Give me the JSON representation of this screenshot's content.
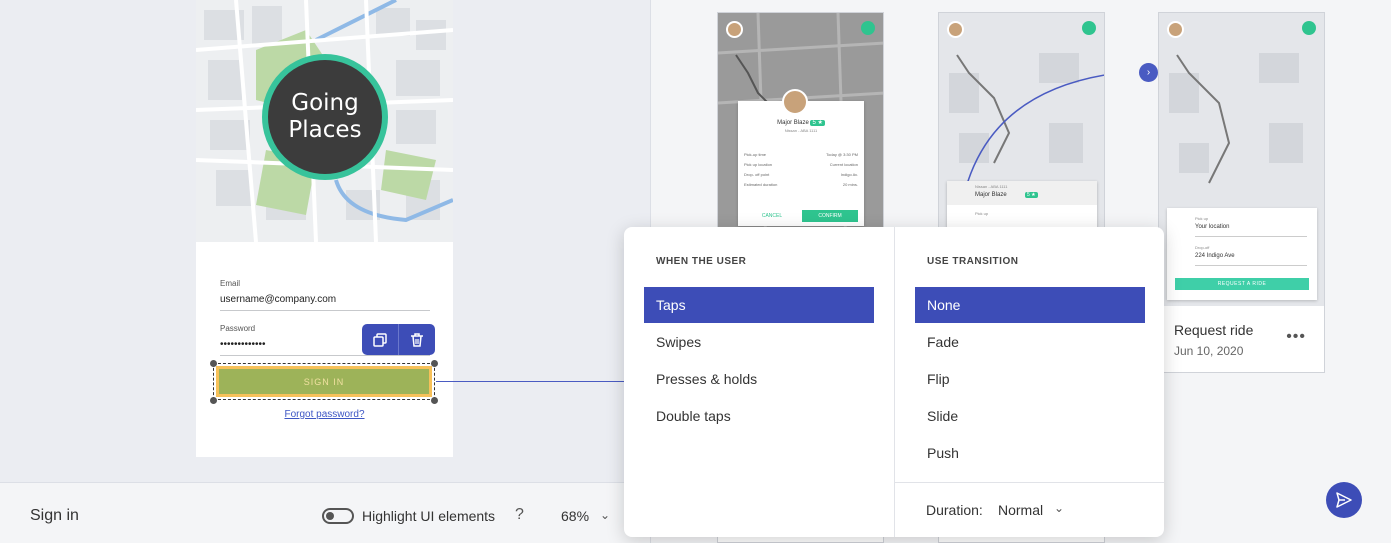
{
  "canvas": {
    "logo_line1": "Going",
    "logo_line2": "Places",
    "email_label": "Email",
    "email_value": "username@company.com",
    "password_label": "Password",
    "password_value": "•••••••••••••",
    "signin_label": "SIGN IN",
    "forgot_label": "Forgot password?"
  },
  "bottom_bar": {
    "screen_name": "Sign in",
    "highlight_label": "Highlight UI elements",
    "help": "?",
    "zoom": "68%",
    "zoom_chevron": "⌄"
  },
  "mini_screens": {
    "first": {
      "driver_name": "Major Blaze",
      "rating": "5 ★",
      "vehicle": "Nissan - ABA 1111",
      "rows": [
        {
          "label": "Pick-up time",
          "value": "Today @ 3:30 PM"
        },
        {
          "label": "Pick up location",
          "value": "Current location"
        },
        {
          "label": "Drop- off point",
          "value": "Indigo Av."
        },
        {
          "label": "Estimated duration",
          "value": "20 mins."
        }
      ],
      "cancel": "CANCEL",
      "confirm": "CONFIRM"
    },
    "second": {
      "vehicle": "Nissan - ABA 1111",
      "driver_name": "Major Blaze",
      "rating": "5 ★",
      "pickup": "Pick up"
    },
    "third": {
      "pickup_label": "Pick up",
      "pickup_value": "Your location",
      "dropoff_label": "Drop-off",
      "dropoff_value": "224 Indigo Ave",
      "request_btn": "REQUEST A RIDE",
      "title": "Request ride",
      "date": "Jun 10, 2020",
      "more": "•••"
    }
  },
  "popover": {
    "when_heading": "WHEN THE USER",
    "when_options": [
      "Taps",
      "Swipes",
      "Presses & holds",
      "Double taps"
    ],
    "transition_heading": "USE TRANSITION",
    "transition_options": [
      "None",
      "Fade",
      "Flip",
      "Slide",
      "Push"
    ],
    "duration_label": "Duration:",
    "duration_value": "Normal",
    "duration_chevron": "⌄"
  },
  "icons": {
    "proto_arrow": "›"
  },
  "colors": {
    "accent": "#3d4db7",
    "brand_green": "#37c39b",
    "signin_fill": "#9db359",
    "selection_outline": "#f7c15a"
  }
}
